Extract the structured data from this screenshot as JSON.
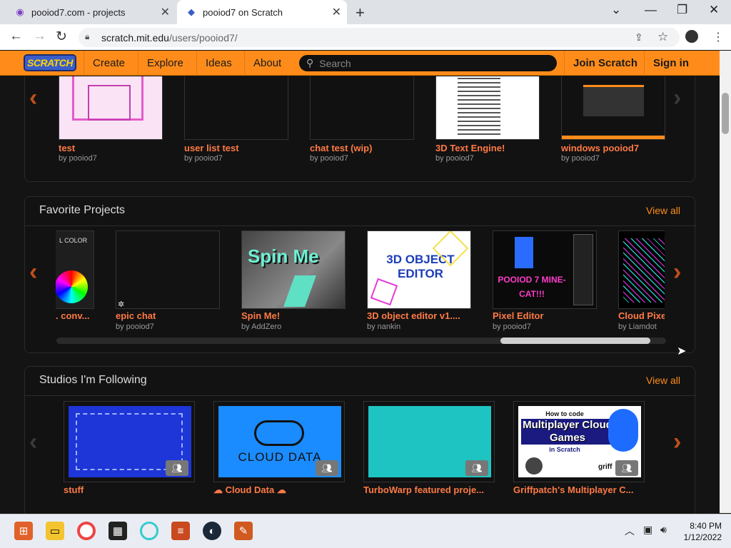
{
  "browser": {
    "tabs": [
      {
        "title": "pooiod7.com - projects",
        "active": false
      },
      {
        "title": "pooiod7 on Scratch",
        "active": true
      }
    ],
    "url_domain": "scratch.mit.edu",
    "url_path": "/users/pooiod7/"
  },
  "header": {
    "logo": "SCRATCH",
    "nav": [
      "Create",
      "Explore",
      "Ideas",
      "About"
    ],
    "search_placeholder": "Search",
    "join": "Join Scratch",
    "signin": "Sign in"
  },
  "shared_projects": [
    {
      "title": "test",
      "by": "by pooiod7"
    },
    {
      "title": "user list test",
      "by": "by pooiod7"
    },
    {
      "title": "chat test (wip)",
      "by": "by pooiod7"
    },
    {
      "title": "3D Text Engine!",
      "by": "by pooiod7"
    },
    {
      "title": "windows pooiod7",
      "by": "by pooiod7"
    }
  ],
  "favorites": {
    "heading": "Favorite Projects",
    "view_all": "View all",
    "items": [
      {
        "title": ". conv...",
        "by": "",
        "thumb_text": "L COLOR"
      },
      {
        "title": "epic chat",
        "by": "by pooiod7",
        "thumb_text": ""
      },
      {
        "title": "Spin Me!",
        "by": "by AddZero",
        "thumb_text": "Spin Me"
      },
      {
        "title": "3D object editor v1....",
        "by": "by nankin",
        "thumb_text": "3D OBJECT EDITOR"
      },
      {
        "title": "Pixel Editor",
        "by": "by pooiod7",
        "thumb_text": "POOIOD 7 MINE-CAT!!!"
      },
      {
        "title": "Cloud Pixe",
        "by": "by Liamdot",
        "thumb_text": ""
      }
    ]
  },
  "studios": {
    "heading": "Studios I'm Following",
    "view_all": "View all",
    "items": [
      {
        "title": "stuff",
        "thumb_text": ""
      },
      {
        "title": "☁ Cloud Data ☁",
        "thumb_text": "CLOUD DATA"
      },
      {
        "title": "TurboWarp featured proje...",
        "thumb_text": ""
      },
      {
        "title": "Griffpatch's Multiplayer C...",
        "thumb_text": "Multiplayer Cloud Games"
      }
    ],
    "thumb_overlays": [
      "How to code",
      "in Scratch",
      "griff"
    ]
  },
  "taskbar": {
    "time": "8:40 PM",
    "date": "1/12/2022"
  },
  "colors": {
    "accent": "#ff8c1a",
    "title": "#ff7a45",
    "bg": "#141414"
  }
}
